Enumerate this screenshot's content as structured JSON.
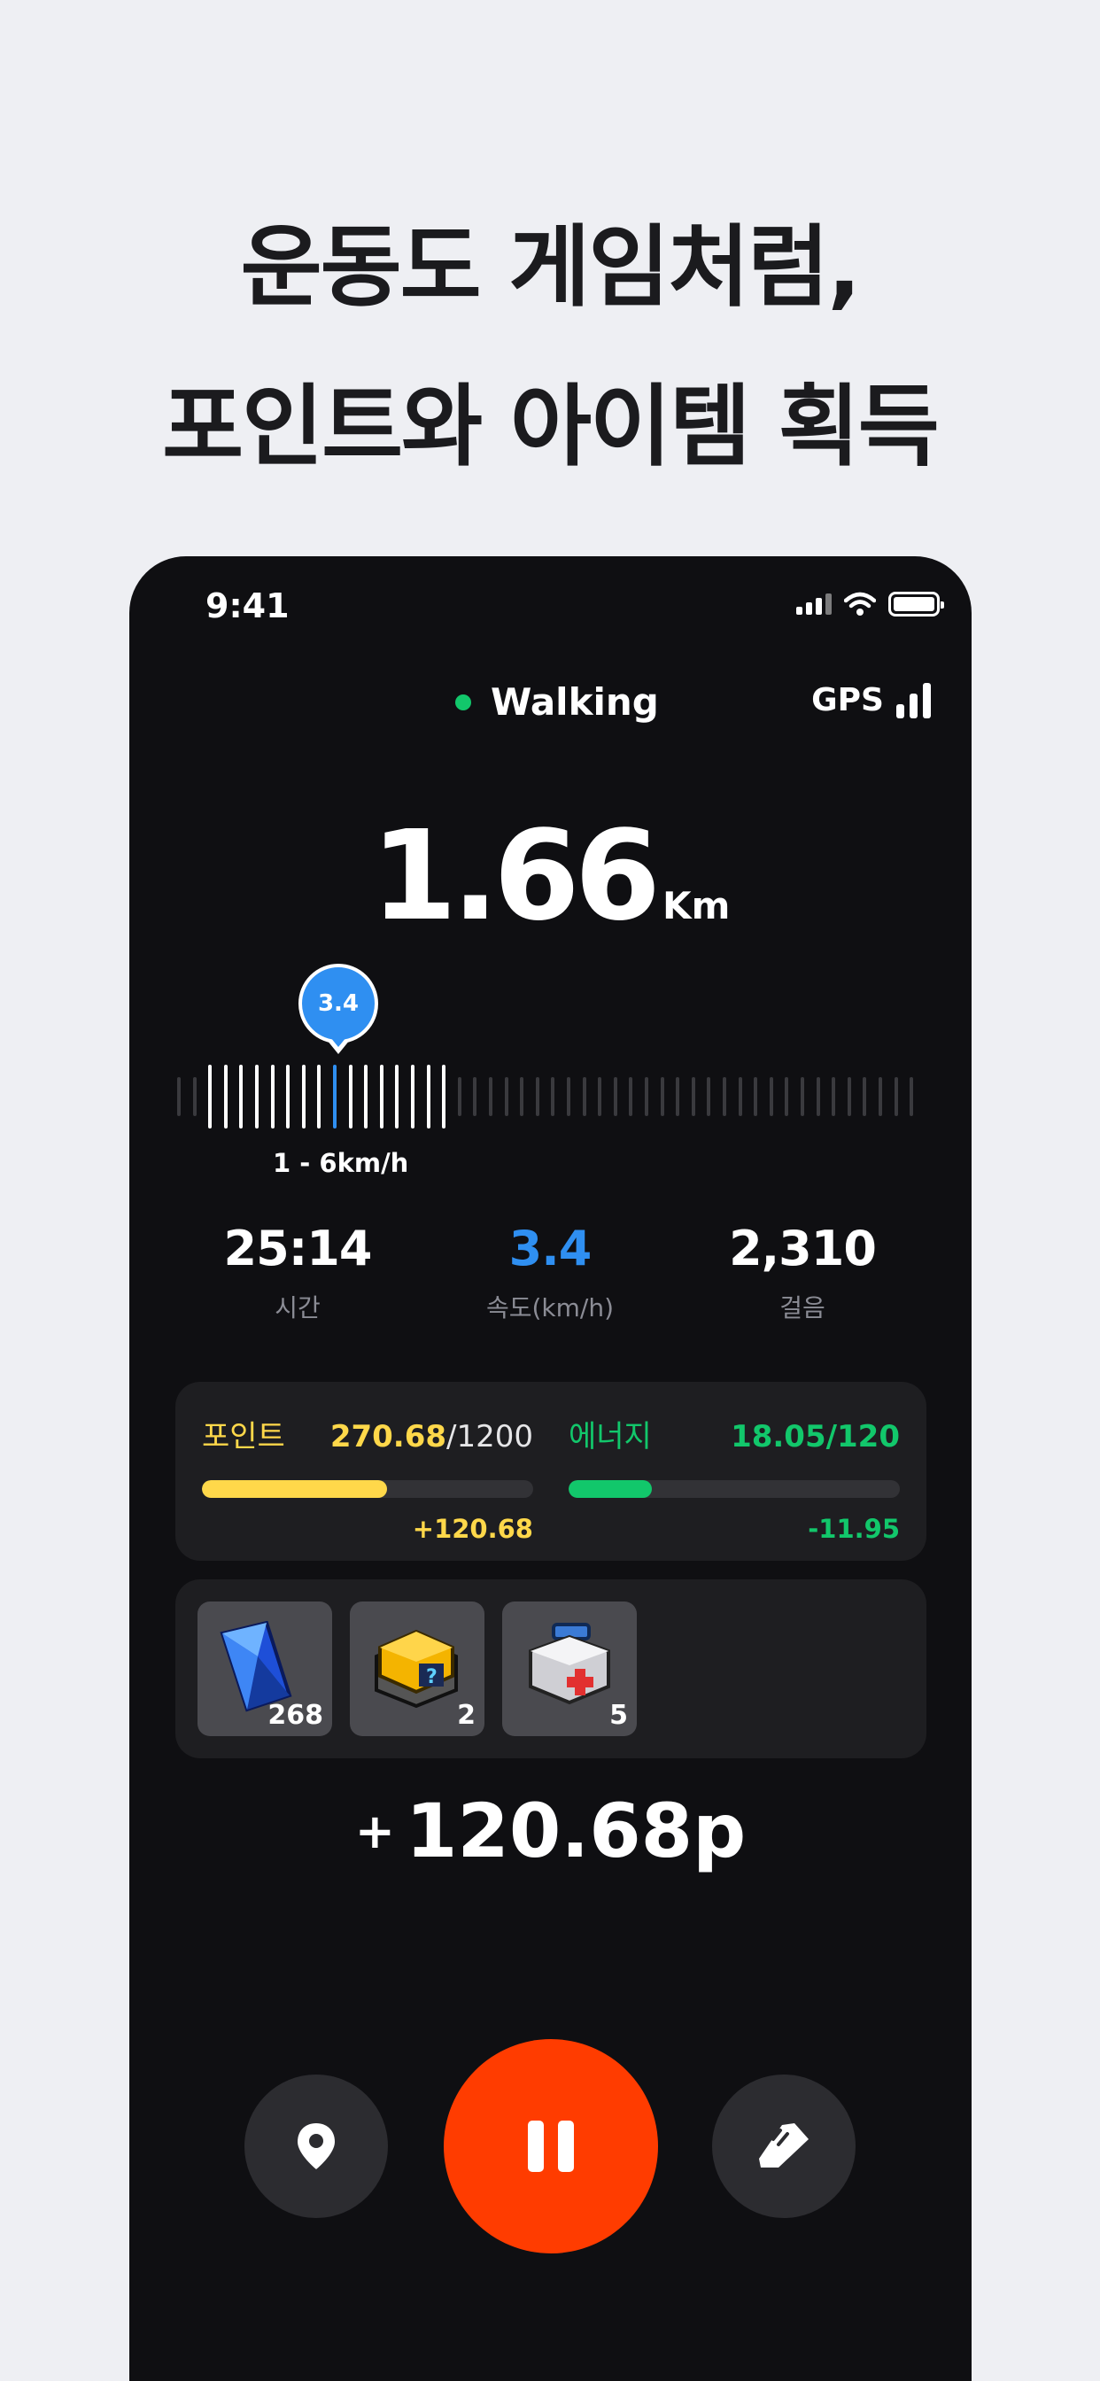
{
  "headline": {
    "line1": "운동도 게임처럼,",
    "line2": "포인트와 아이템 획득"
  },
  "status_bar": {
    "time": "9:41"
  },
  "activity": {
    "mode": "Walking",
    "gps_label": "GPS"
  },
  "distance": {
    "value": "1.66",
    "unit": "Km"
  },
  "speed_gauge": {
    "current": "3.4",
    "range_label": "1 - 6km/h"
  },
  "stats": [
    {
      "value": "25:14",
      "label": "시간"
    },
    {
      "value": "3.4",
      "label": "속도(km/h)"
    },
    {
      "value": "2,310",
      "label": "걸음"
    }
  ],
  "points": {
    "label": "포인트",
    "current": "270.68",
    "max": "/1200",
    "delta": "+120.68",
    "fill_fraction": 0.56
  },
  "energy": {
    "label": "에너지",
    "value": "18.05/120",
    "delta": "-11.95",
    "fill_fraction": 0.25
  },
  "items": [
    {
      "icon": "blue-gem-icon",
      "count": "268"
    },
    {
      "icon": "mystery-box-icon",
      "count": "2"
    },
    {
      "icon": "first-aid-kit-icon",
      "count": "5"
    }
  ],
  "reward": {
    "plus": "+",
    "value": "120.68p"
  },
  "controls": {
    "location": "location-pin-icon",
    "pause": "pause-icon",
    "record": "shoe-icon"
  },
  "colors": {
    "accent_blue": "#2f8ff1",
    "points_yellow": "#ffd84a",
    "energy_green": "#12c76b",
    "pause_orange": "#ff3c00"
  }
}
